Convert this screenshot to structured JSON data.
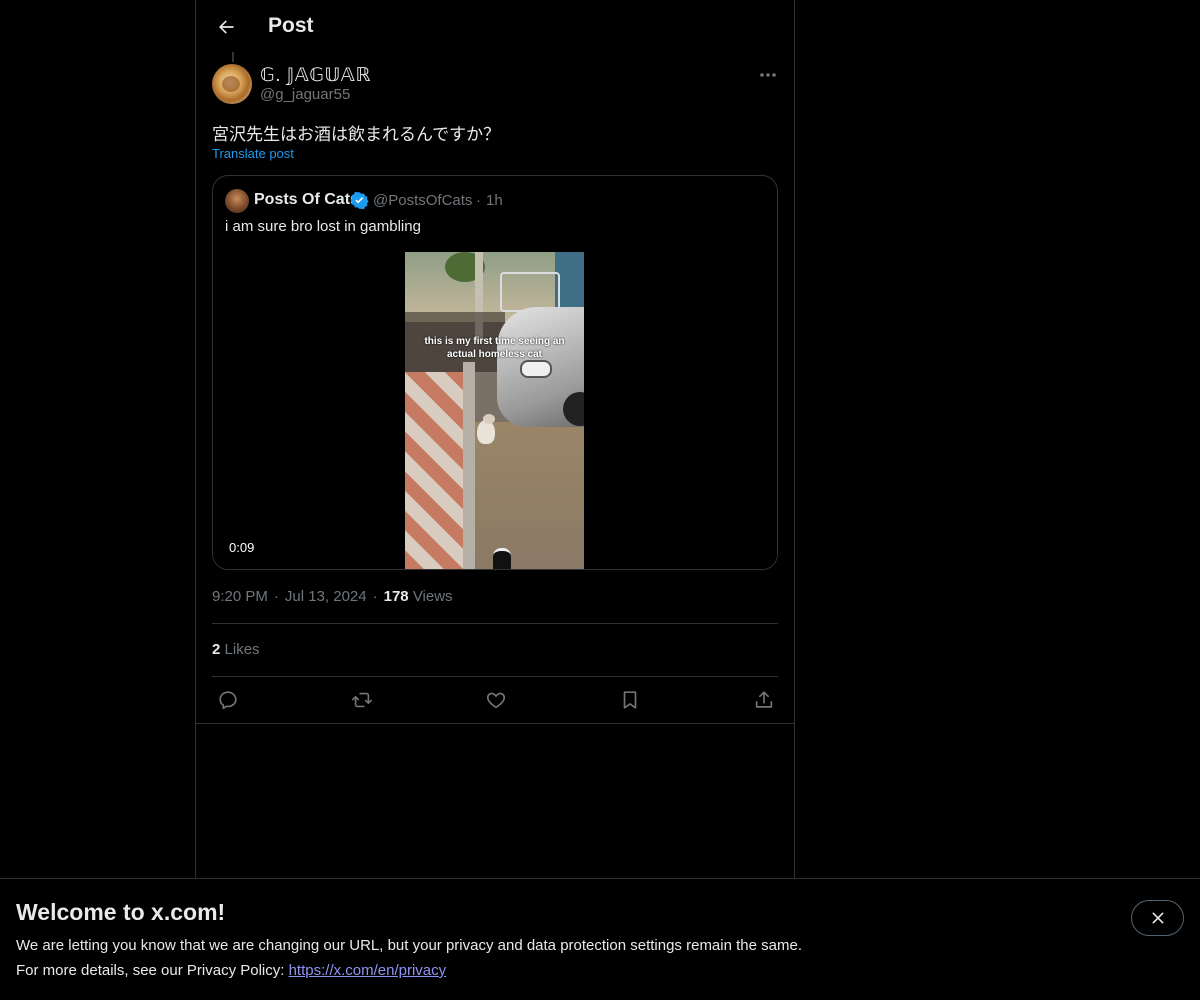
{
  "header": {
    "title": "Post"
  },
  "post": {
    "author_name": "𝔾. 𝕁𝔸𝔾𝕌𝔸ℝ",
    "author_handle": "@g_jaguar55",
    "text": "宮沢先生はお酒は飲まれるんですか？",
    "translate_label": "Translate post",
    "time": "9:20 PM",
    "date": "Jul 13, 2024",
    "views_count": "178",
    "views_label": "Views",
    "likes_count": "2",
    "likes_label": "Likes",
    "meta_separator": "·"
  },
  "quote": {
    "author_name": "Posts Of Cats",
    "author_handle": "@PostsOfCats",
    "separator": "·",
    "time_ago": "1h",
    "text": "i am sure bro lost in gambling",
    "video_caption_line1": "this is my first time seeing an",
    "video_caption_line2": "actual homeless cat",
    "video_duration": "0:09",
    "verified_color": "#1d9bf0"
  },
  "actions": {
    "icons": [
      "reply-icon",
      "retweet-icon",
      "like-icon",
      "bookmark-icon",
      "share-icon"
    ]
  },
  "banner": {
    "title": "Welcome to x.com!",
    "line1": "We are letting you know that we are changing our URL, but your privacy and data protection settings remain the same.",
    "line2_prefix": "For more details, see our Privacy Policy: ",
    "link_text": "https://x.com/en/privacy"
  },
  "colors": {
    "background": "#000000",
    "accent": "#1d9bf0",
    "text_primary": "#e7e9ea",
    "text_secondary": "#71767b",
    "border": "#2f3336",
    "link_banner": "#8e94f2"
  }
}
